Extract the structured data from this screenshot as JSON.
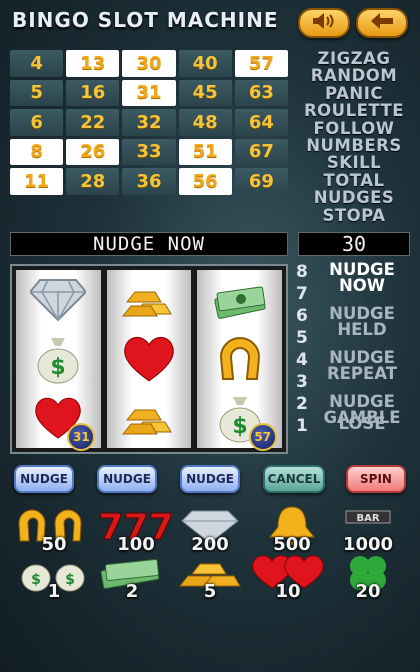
{
  "header": {
    "title": "BINGO SLOT MACHINE",
    "sound_icon": "speaker-icon",
    "back_icon": "back-arrow-icon",
    "button_color": "#f0a020"
  },
  "grid": {
    "rows": [
      [
        {
          "v": "4",
          "lit": false
        },
        {
          "v": "13",
          "lit": true
        },
        {
          "v": "30",
          "lit": true
        },
        {
          "v": "40",
          "lit": false
        },
        {
          "v": "57",
          "lit": true
        }
      ],
      [
        {
          "v": "5",
          "lit": false
        },
        {
          "v": "16",
          "lit": false
        },
        {
          "v": "31",
          "lit": true
        },
        {
          "v": "45",
          "lit": false
        },
        {
          "v": "63",
          "lit": false
        }
      ],
      [
        {
          "v": "6",
          "lit": false
        },
        {
          "v": "22",
          "lit": false
        },
        {
          "v": "32",
          "lit": false
        },
        {
          "v": "48",
          "lit": false
        },
        {
          "v": "64",
          "lit": false
        }
      ],
      [
        {
          "v": "8",
          "lit": true
        },
        {
          "v": "26",
          "lit": true
        },
        {
          "v": "33",
          "lit": false
        },
        {
          "v": "51",
          "lit": true
        },
        {
          "v": "67",
          "lit": false
        }
      ],
      [
        {
          "v": "11",
          "lit": true
        },
        {
          "v": "28",
          "lit": false
        },
        {
          "v": "36",
          "lit": false
        },
        {
          "v": "56",
          "lit": true
        },
        {
          "v": "69",
          "lit": false
        }
      ]
    ]
  },
  "features": [
    "ZIGZAG",
    "RANDOM",
    "PANIC",
    "ROULETTE",
    "FOLLOW",
    "NUMBERS",
    "SKILL",
    "TOTAL",
    "NUDGES",
    "STOPA"
  ],
  "banner": {
    "text": "NUDGE NOW"
  },
  "counter": {
    "value": "30"
  },
  "reels": [
    {
      "symbols": [
        "diamond-icon",
        "money-bag-icon",
        "heart-icon"
      ],
      "ball": "31"
    },
    {
      "symbols": [
        "gold-bars-icon",
        "heart-icon",
        "gold-bars-icon"
      ],
      "ball": null
    },
    {
      "symbols": [
        "cash-stack-icon",
        "horseshoe-icon",
        "money-bag-icon"
      ],
      "ball": "57"
    }
  ],
  "ladder": [
    {
      "n": "8",
      "label": "NUDGE NOW",
      "active": true
    },
    {
      "n": "7",
      "label": "",
      "active": false
    },
    {
      "n": "6",
      "label": "NUDGE HELD",
      "active": false
    },
    {
      "n": "5",
      "label": "",
      "active": false
    },
    {
      "n": "4",
      "label": "NUDGE REPEAT",
      "active": false
    },
    {
      "n": "3",
      "label": "",
      "active": false
    },
    {
      "n": "2",
      "label": "NUDGE GAMBLE",
      "active": false
    },
    {
      "n": "1",
      "label": "LOSE",
      "active": false
    }
  ],
  "buttons": {
    "nudge1": "NUDGE",
    "nudge2": "NUDGE",
    "nudge3": "NUDGE",
    "cancel": "CANCEL",
    "spin": "SPIN"
  },
  "paytable": [
    {
      "icon": "horseshoe-icon",
      "amount": "50"
    },
    {
      "icon": "sevens-icon",
      "amount": "100"
    },
    {
      "icon": "diamond-icon",
      "amount": "200"
    },
    {
      "icon": "bell-icon",
      "amount": "500"
    },
    {
      "icon": "bar-icon",
      "amount": "1000",
      "bar_text": "BAR"
    },
    {
      "icon": "money-bags-icon",
      "amount": "1"
    },
    {
      "icon": "cash-stack-icon",
      "amount": "2"
    },
    {
      "icon": "gold-bars-icon",
      "amount": "5"
    },
    {
      "icon": "hearts-icon",
      "amount": "10"
    },
    {
      "icon": "clover-icon",
      "amount": "20"
    }
  ]
}
